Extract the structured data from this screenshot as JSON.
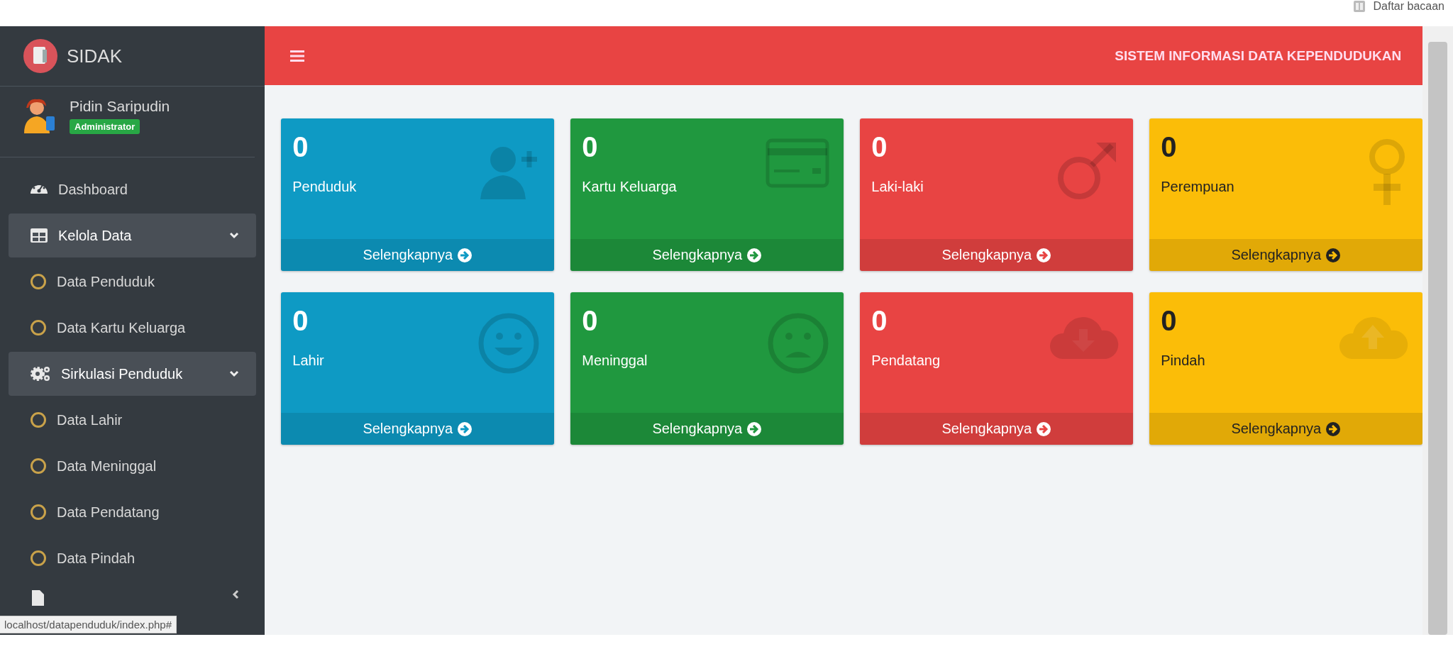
{
  "browser": {
    "reading_list": "Daftar bacaan"
  },
  "sidebar": {
    "brand": "SIDAK",
    "user": {
      "name": "Pidin Saripudin",
      "role": "Administrator"
    },
    "menu": [
      {
        "kind": "link",
        "label": "Dashboard"
      },
      {
        "kind": "group",
        "label": "Kelola Data",
        "expanded": true,
        "children": [
          {
            "label": "Data Penduduk"
          },
          {
            "label": "Data Kartu Keluarga"
          }
        ]
      },
      {
        "kind": "group",
        "label": "Sirkulasi Penduduk",
        "expanded": true,
        "children": [
          {
            "label": "Data Lahir"
          },
          {
            "label": "Data Meninggal"
          },
          {
            "label": "Data Pendatang"
          },
          {
            "label": "Data Pindah"
          }
        ]
      },
      {
        "kind": "group",
        "expanded": false
      }
    ]
  },
  "header": {
    "title": "SISTEM INFORMASI DATA KEPENDUDUKAN"
  },
  "cards": [
    {
      "count": "0",
      "label": "Penduduk",
      "link": "Selengkapnya",
      "color": "#0e9ac4"
    },
    {
      "count": "0",
      "label": "Kartu Keluarga",
      "link": "Selengkapnya",
      "color": "#20983f"
    },
    {
      "count": "0",
      "label": "Laki-laki",
      "link": "Selengkapnya",
      "color": "#e84443"
    },
    {
      "count": "0",
      "label": "Perempuan",
      "link": "Selengkapnya",
      "color": "#fbbd08"
    },
    {
      "count": "0",
      "label": "Lahir",
      "link": "Selengkapnya",
      "color": "#0e9ac4"
    },
    {
      "count": "0",
      "label": "Meninggal",
      "link": "Selengkapnya",
      "color": "#20983f"
    },
    {
      "count": "0",
      "label": "Pendatang",
      "link": "Selengkapnya",
      "color": "#e84443"
    },
    {
      "count": "0",
      "label": "Pindah",
      "link": "Selengkapnya",
      "color": "#fbbd08"
    }
  ],
  "status_url": "localhost/datapenduduk/index.php#"
}
